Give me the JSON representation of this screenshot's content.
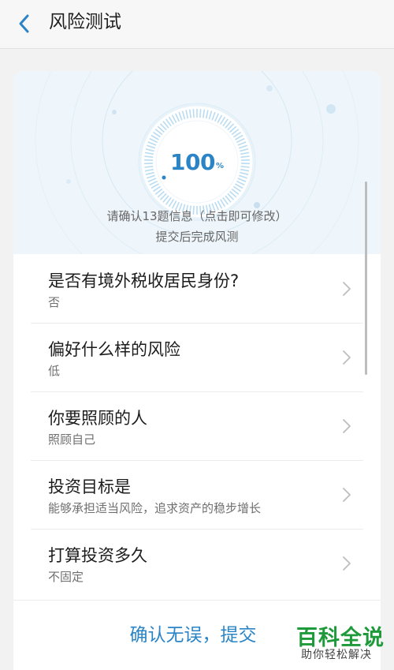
{
  "header": {
    "title": "风险测试",
    "back_icon": "chevron-left-icon"
  },
  "progress": {
    "value": 100,
    "unit": "%",
    "line1": "请确认13题信息（点击即可修改）",
    "line2": "提交后完成风测"
  },
  "questions": [
    {
      "question": "是否有境外税收居民身份?",
      "answer": "否"
    },
    {
      "question": "偏好什么样的风险",
      "answer": "低"
    },
    {
      "question": "你要照顾的人",
      "answer": "照顾自己"
    },
    {
      "question": "投资目标是",
      "answer": "能够承担适当风险，追求资产的稳步增长"
    },
    {
      "question": "打算投资多久",
      "answer": "不固定"
    }
  ],
  "footer": {
    "submit_label": "确认无误，提交"
  },
  "watermark": {
    "main": "百科全说",
    "sub": "助你轻松解决"
  },
  "colors": {
    "accent": "#2a84c6",
    "background": "#f2f2f2",
    "hero_background": "#eef6fb",
    "watermark_green": "#1f9a3a"
  }
}
